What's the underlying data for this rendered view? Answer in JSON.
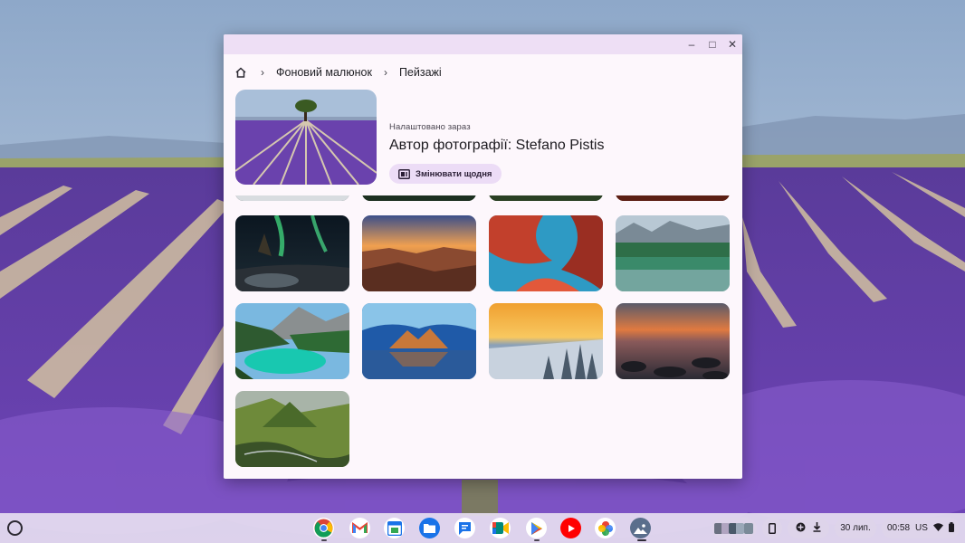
{
  "window": {
    "breadcrumb": {
      "home_icon": "home-icon",
      "separator": "›",
      "section": "Фоновий малюнок",
      "collection": "Пейзажі"
    },
    "controls": {
      "minimize": "–",
      "maximize": "□",
      "close": "✕"
    },
    "current": {
      "label": "Налаштовано зараз",
      "author": "Автор фотографії: Stefano Pistis",
      "daily_button": "Змінювати щодня",
      "daily_icon": "slideshow-icon"
    },
    "collection_tiles": [
      {
        "name": "partial-row-1",
        "colors": [
          "#2f3a36",
          "#1f2b28"
        ]
      },
      {
        "name": "partial-row-2",
        "colors": [
          "#2e4a2f",
          "#1e3322"
        ]
      },
      {
        "name": "partial-row-3",
        "colors": [
          "#3c5a32",
          "#2a4024"
        ]
      },
      {
        "name": "partial-row-4",
        "colors": [
          "#8e3a28",
          "#5c1f14"
        ]
      },
      {
        "name": "aurora-night",
        "colors": [
          "#0d1a24",
          "#3fb87a"
        ]
      },
      {
        "name": "canyon-sunset",
        "colors": [
          "#d9864a",
          "#6b3a2a"
        ]
      },
      {
        "name": "red-blue-canyon",
        "colors": [
          "#c2402c",
          "#2e9ac4"
        ]
      },
      {
        "name": "mountain-lake",
        "colors": [
          "#9fb8c8",
          "#2e6e58"
        ]
      },
      {
        "name": "turquoise-lake",
        "colors": [
          "#58a8d8",
          "#18b8a8"
        ]
      },
      {
        "name": "ice-cave",
        "colors": [
          "#2a6ab8",
          "#c8783a"
        ]
      },
      {
        "name": "snowy-forest-sunrise",
        "colors": [
          "#f0a030",
          "#d8dde8"
        ]
      },
      {
        "name": "rocky-shore-sunset",
        "colors": [
          "#d8683a",
          "#2a2a34"
        ]
      },
      {
        "name": "green-valley",
        "colors": [
          "#6e8a3a",
          "#3a5228"
        ]
      }
    ]
  },
  "shelf": {
    "launcher_icon": "launcher-icon",
    "apps": [
      {
        "name": "chrome-icon",
        "color": "#4285f4"
      },
      {
        "name": "gmail-icon",
        "color": "#ea4335"
      },
      {
        "name": "calendar-icon",
        "color": "#1a73e8"
      },
      {
        "name": "files-icon",
        "color": "#1a73e8"
      },
      {
        "name": "messages-icon",
        "color": "#1a73e8"
      },
      {
        "name": "meet-icon",
        "color": "#00897b"
      },
      {
        "name": "play-store-icon",
        "color": "#34a853"
      },
      {
        "name": "youtube-icon",
        "color": "#ff0000"
      },
      {
        "name": "photos-icon",
        "color": "#fbbc04"
      },
      {
        "name": "wallpaper-app-icon",
        "color": "#5a6e8c"
      }
    ],
    "date": "30 лип.",
    "time": "00:58",
    "locale": "US"
  },
  "colors": {
    "window_bg": "#fdf7fc",
    "titlebar_bg": "#eedff5",
    "chip_bg": "#ecdcf6",
    "shelf_bg": "#e6def0"
  }
}
